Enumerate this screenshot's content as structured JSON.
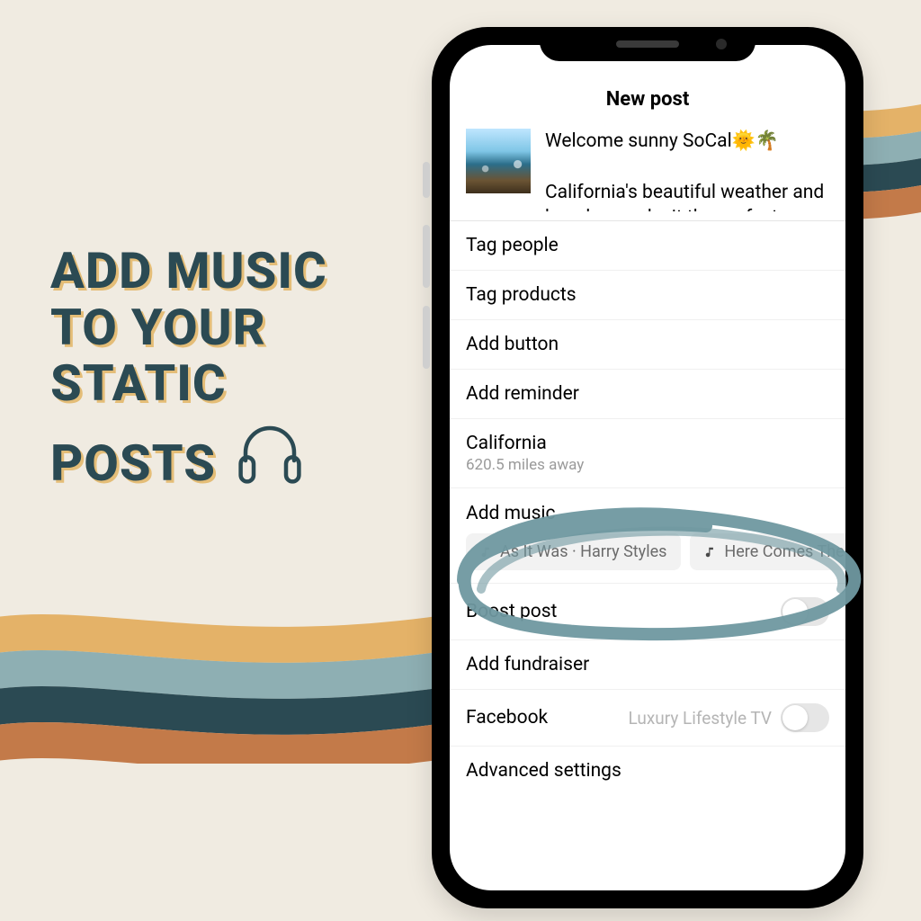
{
  "headline": {
    "line1": "ADD MUSIC",
    "line2": "TO YOUR",
    "line3": "STATIC",
    "line4": "POSTS"
  },
  "palette": {
    "cream": "#f0ebe1",
    "gold": "#e4b268",
    "teal_light": "#8eafb3",
    "teal_dark": "#2b4a53",
    "rust": "#c37a49"
  },
  "phone": {
    "title": "New post",
    "caption": "Welcome sunny SoCal🌞🌴\n\nCalifornia's beautiful weather and beaches make it the perfect destination",
    "rows": {
      "tag_people": "Tag people",
      "tag_products": "Tag products",
      "add_button": "Add button",
      "add_reminder": "Add reminder",
      "location_name": "California",
      "location_distance": "620.5 miles away",
      "add_music": "Add music",
      "boost_post": "Boost post",
      "add_fundraiser": "Add fundraiser",
      "facebook": "Facebook",
      "facebook_page": "Luxury Lifestyle TV",
      "advanced": "Advanced settings"
    },
    "music_chips": [
      "As It Was · Harry Styles",
      "Here Comes The"
    ]
  }
}
